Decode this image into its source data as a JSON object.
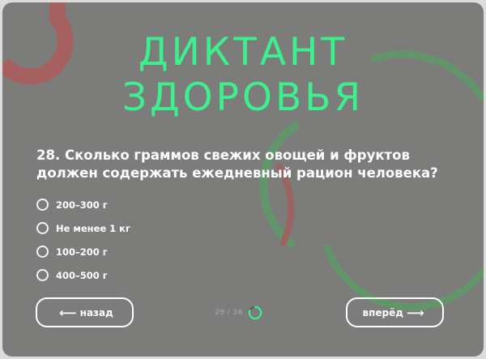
{
  "title_lines": [
    "ДИКТАНТ",
    "ЗДОРОВЬЯ"
  ],
  "question": "28. Сколько граммов свежих овощей и фруктов должен содержать ежедневный рацион человека?",
  "options": [
    {
      "label": "200–300 г",
      "selected": false
    },
    {
      "label": "Не менее 1 кг",
      "selected": false
    },
    {
      "label": "100–200 г",
      "selected": false
    },
    {
      "label": "400–500 г",
      "selected": false
    }
  ],
  "nav": {
    "back_label": "назад",
    "next_label": "вперёд",
    "back_icon": "arrow-left-icon",
    "next_icon": "arrow-right-icon"
  },
  "progress": {
    "text": "29 / 36",
    "current": 29,
    "total": 36
  },
  "colors": {
    "accent": "#3df08e",
    "card_bg": "#7c7d7b",
    "deco_red": "#b3595a",
    "deco_green": "#7fae87"
  }
}
